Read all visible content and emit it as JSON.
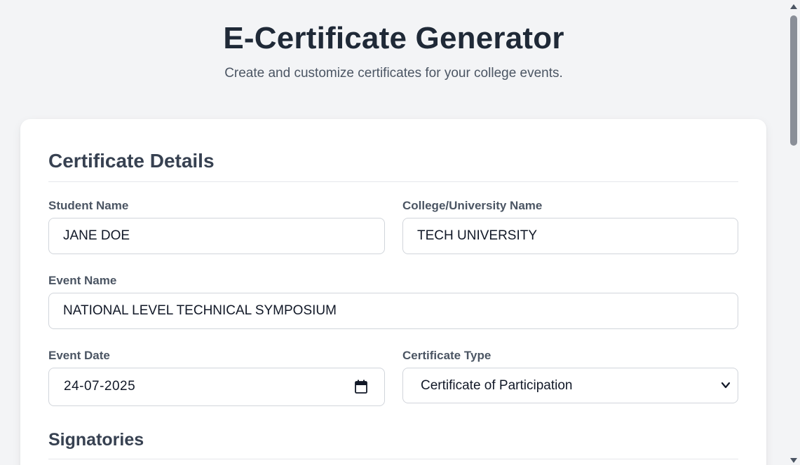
{
  "header": {
    "title": "E-Certificate Generator",
    "subtitle": "Create and customize certificates for your college events."
  },
  "certificate_details": {
    "heading": "Certificate Details",
    "student_name": {
      "label": "Student Name",
      "value": "JANE DOE"
    },
    "college_name": {
      "label": "College/University Name",
      "value": "TECH UNIVERSITY"
    },
    "event_name": {
      "label": "Event Name",
      "value": "NATIONAL LEVEL TECHNICAL SYMPOSIUM"
    },
    "event_date": {
      "label": "Event Date",
      "value": "24-07-2025",
      "icon": "calendar-icon"
    },
    "certificate_type": {
      "label": "Certificate Type",
      "value": "Certificate of Participation",
      "icon": "chevron-down-icon"
    }
  },
  "signatories": {
    "heading": "Signatories"
  },
  "colors": {
    "page_background": "#f3f4f6",
    "card_background": "#ffffff",
    "heading": "#1f2937",
    "border": "#d1d5db"
  }
}
